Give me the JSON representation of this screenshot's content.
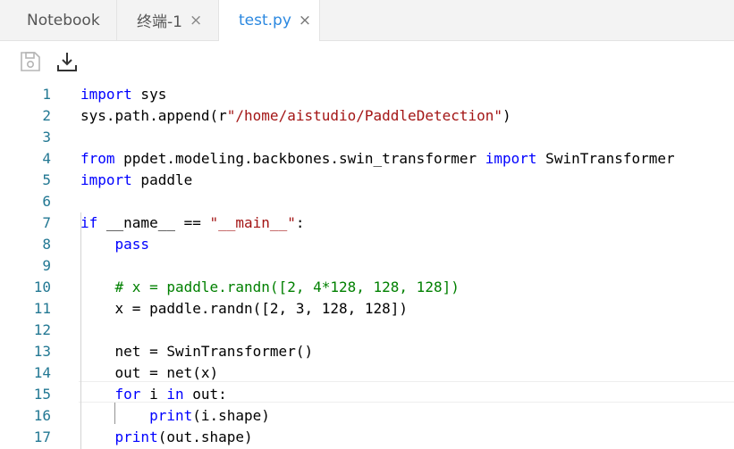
{
  "tabs": [
    {
      "label": "Notebook",
      "closable": false,
      "active": false
    },
    {
      "label": "终端-1",
      "closable": true,
      "active": false
    },
    {
      "label": "test.py",
      "closable": true,
      "active": true
    }
  ],
  "tab_close_glyph": "×",
  "toolbar": {
    "icons": [
      "save-icon",
      "download-icon"
    ]
  },
  "colors": {
    "accent": "#2b88e0",
    "keyword": "#0000ff",
    "string": "#a31515",
    "comment": "#008000",
    "line_number": "#237893"
  },
  "editor": {
    "lines": [
      {
        "num": "1",
        "tokens": [
          {
            "t": "import",
            "c": "kw"
          },
          {
            "t": " sys"
          }
        ]
      },
      {
        "num": "2",
        "tokens": [
          {
            "t": "sys.path.append(r"
          },
          {
            "t": "\"/home/aistudio/PaddleDetection\"",
            "c": "str"
          },
          {
            "t": ")"
          }
        ]
      },
      {
        "num": "3",
        "tokens": []
      },
      {
        "num": "4",
        "tokens": [
          {
            "t": "from",
            "c": "kw"
          },
          {
            "t": " ppdet.modeling.backbones.swin_transformer "
          },
          {
            "t": "import",
            "c": "kw"
          },
          {
            "t": " SwinTransformer"
          }
        ]
      },
      {
        "num": "5",
        "tokens": [
          {
            "t": "import",
            "c": "kw"
          },
          {
            "t": " paddle"
          }
        ]
      },
      {
        "num": "6",
        "tokens": []
      },
      {
        "num": "7",
        "tokens": [
          {
            "t": "if",
            "c": "kw"
          },
          {
            "t": " __name__ == "
          },
          {
            "t": "\"__main__\"",
            "c": "str"
          },
          {
            "t": ":"
          }
        ]
      },
      {
        "num": "8",
        "tokens": [
          {
            "t": "    "
          },
          {
            "t": "pass",
            "c": "kw"
          }
        ]
      },
      {
        "num": "9",
        "tokens": []
      },
      {
        "num": "10",
        "tokens": [
          {
            "t": "    "
          },
          {
            "t": "# x = paddle.randn([2, 4*128, 128, 128])",
            "c": "cmt"
          }
        ]
      },
      {
        "num": "11",
        "tokens": [
          {
            "t": "    x = paddle.randn([2, 3, 128, 128])"
          }
        ]
      },
      {
        "num": "12",
        "tokens": []
      },
      {
        "num": "13",
        "tokens": [
          {
            "t": "    net = SwinTransformer()"
          }
        ]
      },
      {
        "num": "14",
        "tokens": [
          {
            "t": "    out = net(x)"
          }
        ]
      },
      {
        "num": "15",
        "tokens": [
          {
            "t": "    "
          },
          {
            "t": "for",
            "c": "kw"
          },
          {
            "t": " i "
          },
          {
            "t": "in",
            "c": "kw"
          },
          {
            "t": " out:"
          }
        ]
      },
      {
        "num": "16",
        "tokens": [
          {
            "t": "        "
          },
          {
            "t": "print",
            "c": "kw"
          },
          {
            "t": "(i.shape)"
          }
        ]
      },
      {
        "num": "17",
        "tokens": [
          {
            "t": "    "
          },
          {
            "t": "print",
            "c": "kw"
          },
          {
            "t": "(out.shape)"
          }
        ]
      }
    ]
  }
}
